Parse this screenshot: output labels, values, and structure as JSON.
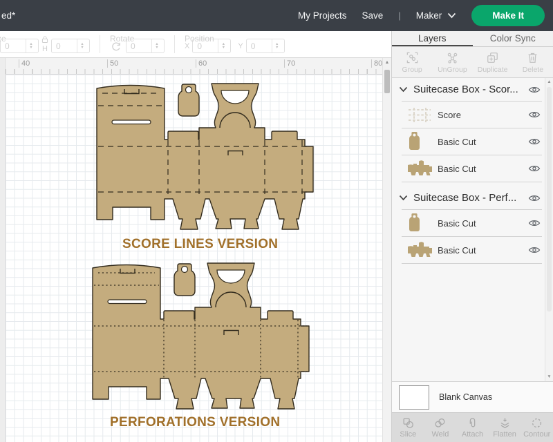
{
  "topbar": {
    "title": "ed*",
    "my_projects": "My Projects",
    "save": "Save",
    "divider": "|",
    "machine": "Maker",
    "make_it": "Make It"
  },
  "toolbar": {
    "size_label_truncated": "ze",
    "w_value": "0",
    "h_label": "H",
    "h_value": "0",
    "rotate_label": "Rotate",
    "rotate_value": "0",
    "position_label": "Position",
    "x_label": "X",
    "x_value": "0",
    "y_label": "Y",
    "y_value": "0"
  },
  "ruler": {
    "ticks": [
      "40",
      "50",
      "60",
      "70",
      "80"
    ]
  },
  "canvas": {
    "labels": {
      "score": "SCORE LINES VERSION",
      "perforations": "PERFORATIONS VERSION"
    }
  },
  "layers_panel": {
    "tabs": [
      {
        "label": "Layers"
      },
      {
        "label": "Color Sync"
      }
    ],
    "actions": [
      {
        "label": "Group"
      },
      {
        "label": "UnGroup"
      },
      {
        "label": "Duplicate"
      },
      {
        "label": "Delete"
      }
    ],
    "groups": [
      {
        "title": "Suitecase Box - Scor...",
        "items": [
          {
            "label": "Score",
            "thumb": "score-pattern"
          },
          {
            "label": "Basic Cut",
            "thumb": "tag-shape"
          },
          {
            "label": "Basic Cut",
            "thumb": "box-template-shape"
          }
        ]
      },
      {
        "title": "Suitecase Box - Perf...",
        "items": [
          {
            "label": "Basic Cut",
            "thumb": "tag-shape"
          },
          {
            "label": "Basic Cut",
            "thumb": "box-template-shape"
          }
        ]
      }
    ],
    "blank_canvas": "Blank Canvas",
    "bottom_actions": [
      {
        "label": "Slice"
      },
      {
        "label": "Weld"
      },
      {
        "label": "Attach"
      },
      {
        "label": "Flatten"
      },
      {
        "label": "Contour"
      }
    ]
  },
  "icons": {
    "topbar": [
      "chevron-down-icon"
    ],
    "toolbar": [
      "lock-icon",
      "rotate-icon",
      "stepper-up-icon",
      "stepper-down-icon"
    ],
    "layers": [
      "chevron-down-icon",
      "eye-icon"
    ],
    "actions": [
      "group-icon",
      "ungroup-icon",
      "duplicate-icon",
      "delete-icon"
    ],
    "bottom": [
      "slice-icon",
      "weld-icon",
      "attach-icon",
      "flatten-icon",
      "contour-icon"
    ]
  },
  "colors": {
    "accent_green": "#0aa66b",
    "shape_tan": "#c4ac7e",
    "shape_outline": "#332c1e",
    "label_brown": "#a1702a",
    "topbar_bg": "#3a3f46"
  }
}
